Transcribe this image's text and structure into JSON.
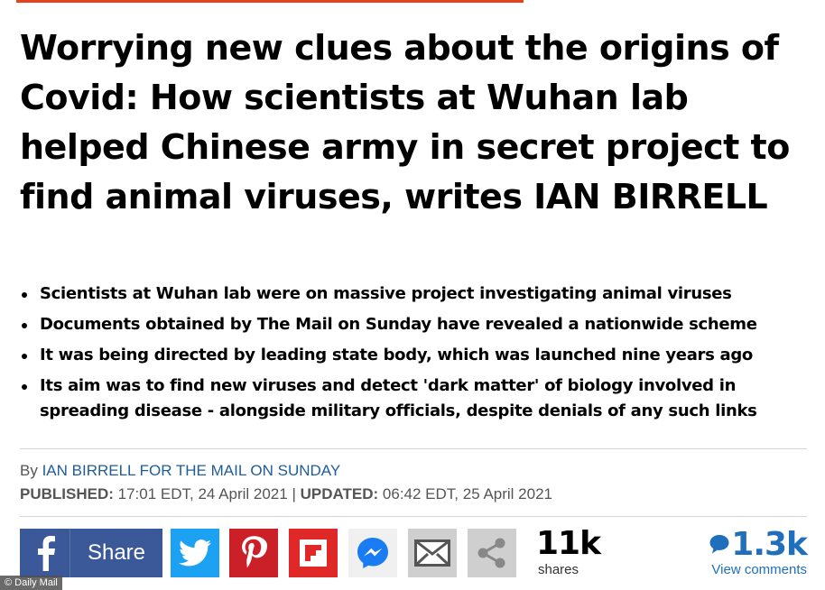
{
  "article": {
    "headline": "Worrying new clues about the origins of Covid: How scientists at Wuhan lab helped Chinese army in secret project to find animal viruses, writes IAN BIRRELL",
    "bullets": [
      "Scientists at Wuhan lab were on massive project investigating animal viruses",
      "Documents obtained by The Mail on Sunday have revealed a nationwide scheme",
      "It was being directed by leading state body, which was launched nine years ago",
      "Its aim was to find new viruses and detect 'dark matter' of biology involved in spreading disease - alongside military officials, despite denials of any such links"
    ],
    "byline_prefix": "By",
    "byline_author": "IAN BIRRELL FOR THE MAIL ON SUNDAY",
    "published_label": "PUBLISHED:",
    "published_value": "17:01 EDT, 24 April 2021",
    "separator": "|",
    "updated_label": "UPDATED:",
    "updated_value": "06:42 EDT, 25 April 2021"
  },
  "share": {
    "facebook_label": "Share",
    "share_count": "11k",
    "share_count_label": "shares",
    "comment_count": "1.3k",
    "comment_link_label": "View comments",
    "icons": [
      "facebook-icon",
      "twitter-icon",
      "pinterest-icon",
      "flipboard-icon",
      "messenger-icon",
      "email-icon",
      "more-share-icon",
      "comment-bubble-icon"
    ]
  },
  "watermark": "© Daily Mail",
  "colors": {
    "accent_rule": "#e4431f",
    "facebook": "#3b5998",
    "twitter": "#1da1f2",
    "pinterest": "#cb2027",
    "flipboard": "#e12828",
    "link": "#1f6fbd"
  }
}
